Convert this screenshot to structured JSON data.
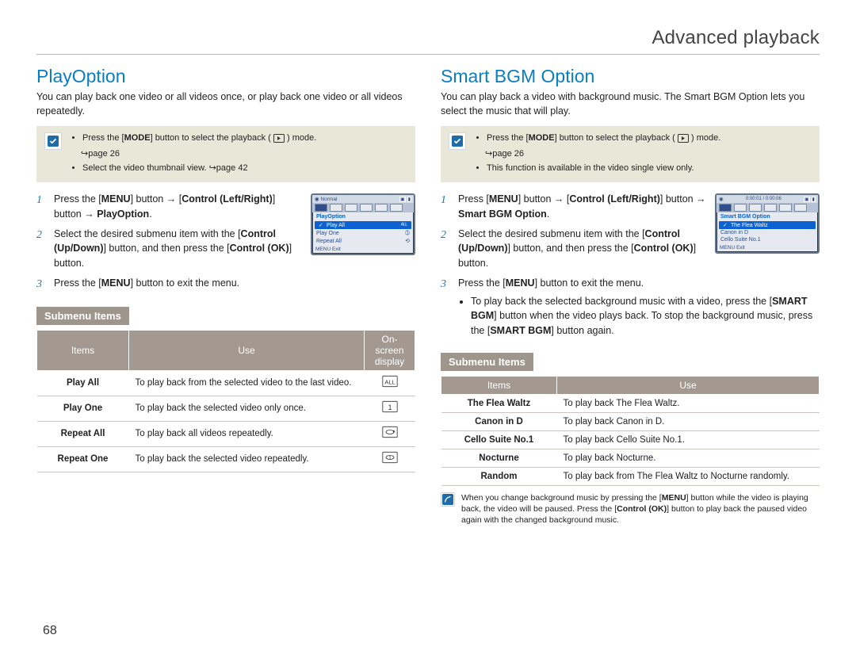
{
  "page": {
    "title": "Advanced playback",
    "number": "68"
  },
  "left": {
    "heading": "PlayOption",
    "intro": "You can play back one video or all videos once, or play back one video or all videos repeatedly.",
    "note1_pre": "Press the [",
    "note1_mode": "MODE",
    "note1_mid": "] button to select the playback (",
    "note1_post": ") mode.",
    "note1_ref": "↪page 26",
    "note2": "Select the video thumbnail view. ↪page 42",
    "step1_a": "Press the [",
    "step1_menu": "MENU",
    "step1_b": "] button → [",
    "step1_ctrl": "Control (Left/Right)",
    "step1_c": "] button → ",
    "step1_target": "PlayOption",
    "step1_end": ".",
    "step2_a": "Select the desired submenu item with the [",
    "step2_ctrl": "Control (Up/Down)",
    "step2_b": "] button, and then press the [",
    "step2_ok": "Control (OK)",
    "step2_c": "] button.",
    "step3_a": "Press the [",
    "step3_menu": "MENU",
    "step3_b": "] button to exit the menu.",
    "screen": {
      "topLeft": "Normal",
      "header": "PlayOption",
      "items": [
        "Play All",
        "Play One",
        "Repeat All"
      ],
      "exit": "MENU  Exit"
    },
    "submenu_label": "Submenu Items",
    "table": {
      "head": {
        "items": "Items",
        "use": "Use",
        "display": "On-screen display"
      },
      "rows": [
        {
          "item": "Play All",
          "use": "To play back from the selected video to the last video."
        },
        {
          "item": "Play One",
          "use": "To play back the selected video only once."
        },
        {
          "item": "Repeat All",
          "use": "To play back all videos repeatedly."
        },
        {
          "item": "Repeat One",
          "use": "To play back the selected video repeatedly."
        }
      ]
    }
  },
  "right": {
    "heading": "Smart BGM Option",
    "intro": "You can play back a video with background music. The Smart BGM Option lets you select the music that will play.",
    "note1_pre": "Press the [",
    "note1_mode": "MODE",
    "note1_mid": "] button to select the playback (",
    "note1_post": ") mode.",
    "note1_ref": "↪page 26",
    "note2": "This function is available in the video single view only.",
    "step1_a": "Press [",
    "step1_menu": "MENU",
    "step1_b": "] button → [",
    "step1_ctrl": "Control (Left/Right)",
    "step1_c": "] button → ",
    "step1_target": "Smart BGM Option",
    "step1_end": ".",
    "step2_a": "Select the desired submenu item with the [",
    "step2_ctrl": "Control (Up/Down)",
    "step2_b": "] button, and then press the [",
    "step2_ok": "Control (OK)",
    "step2_c": "] button.",
    "step3_a": "Press the [",
    "step3_menu": "MENU",
    "step3_b": "] button to exit the menu.",
    "bullet1_a": "To play back the selected background music with a video, press the [",
    "bullet1_btn": "SMART BGM",
    "bullet1_b": "] button when the video plays back. To stop the background music, press the [",
    "bullet1_btn2": "SMART BGM",
    "bullet1_c": "] button again.",
    "screen": {
      "time": "0:00:01 / 0:00:06",
      "header": "Smart BGM Option",
      "items": [
        "The Flea Waltz",
        "Canon in D",
        "Cello Suite No.1"
      ],
      "exit": "MENU  Exit"
    },
    "submenu_label": "Submenu Items",
    "table": {
      "head": {
        "items": "Items",
        "use": "Use"
      },
      "rows": [
        {
          "item": "The Flea Waltz",
          "use": "To play back The Flea Waltz."
        },
        {
          "item": "Canon in D",
          "use": "To play back Canon in D."
        },
        {
          "item": "Cello Suite No.1",
          "use": "To play back Cello Suite No.1."
        },
        {
          "item": "Nocturne",
          "use": "To play back Nocturne."
        },
        {
          "item": "Random",
          "use": "To play back from The Flea Waltz to Nocturne randomly."
        }
      ]
    },
    "footnote_a": "When you change background music by pressing the [",
    "footnote_menu": "MENU",
    "footnote_b": "] button while the video is playing back, the video will be paused. Press the [",
    "footnote_ok": "Control (OK)",
    "footnote_c": "] button to play back the paused video again with the changed background music."
  }
}
